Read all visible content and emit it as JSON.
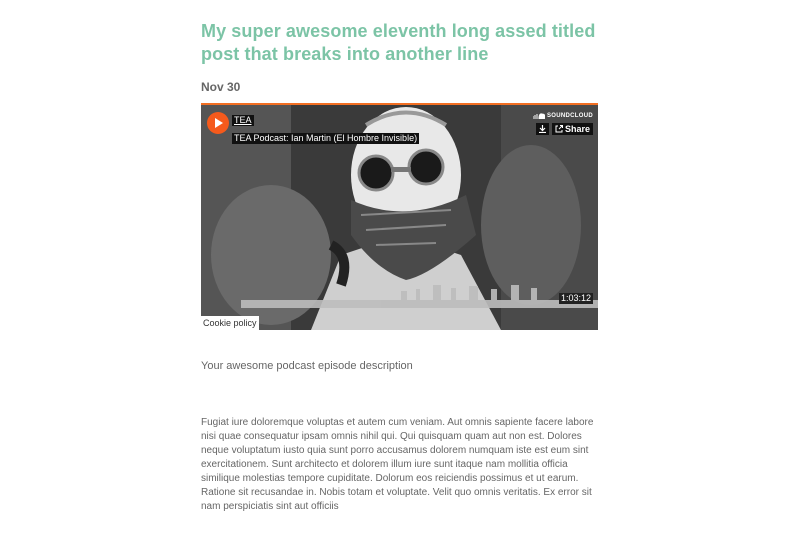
{
  "post": {
    "title": "My super awesome eleventh long assed titled post that breaks into another line",
    "date": "Nov 30",
    "description": "Your awesome podcast episode description",
    "body": "Fugiat iure doloremque voluptas et autem cum veniam. Aut omnis sapiente facere labore nisi quae consequatur ipsam omnis nihil qui. Qui quisquam quam aut non est. Dolores neque voluptatum iusto quia sunt porro accusamus dolorem numquam iste est eum sint exercitationem. Sunt architecto et dolorem illum iure sunt itaque nam mollitia officia similique molestias tempore cupiditate. Dolorum eos reiciendis possimus et ut earum. Ratione sit recusandae in. Nobis totam et voluptate. Velit quo omnis veritatis. Ex error sit nam perspiciatis sint aut officiis"
  },
  "player": {
    "artist": "TEA",
    "track": "TEA Podcast: Ian Martin (El Hombre Invisible)",
    "brand": "SOUNDCLOUD",
    "share_label": "Share",
    "duration": "1:03:12",
    "cookie_label": "Cookie policy",
    "icons": [
      "play-icon",
      "soundcloud-logo-icon",
      "download-icon",
      "share-icon"
    ],
    "accent_color": "#f55a1c"
  },
  "colors": {
    "title": "#7cc4a6",
    "text": "#666666"
  }
}
